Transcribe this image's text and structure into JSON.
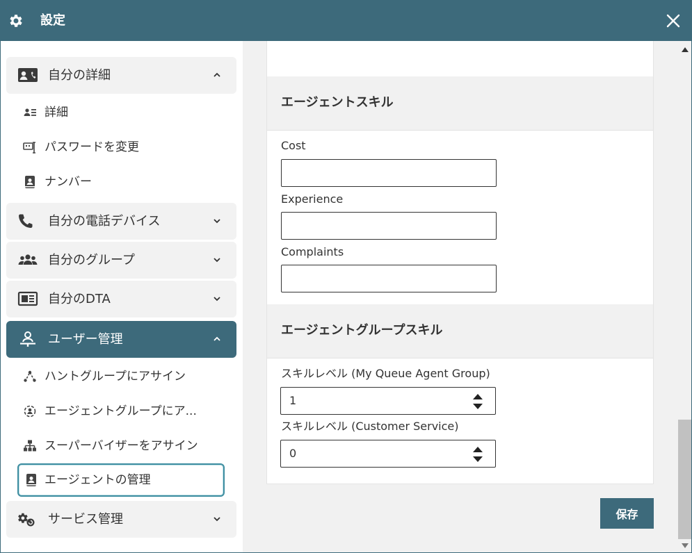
{
  "window": {
    "title": "設定",
    "accent_color": "#3d6a7b"
  },
  "sidebar": {
    "sections": [
      {
        "label": "自分の詳細",
        "icon": "contact-card-icon",
        "expanded": true,
        "items": [
          {
            "label": "詳細",
            "icon": "id-badge-icon"
          },
          {
            "label": "パスワードを変更",
            "icon": "password-icon"
          },
          {
            "label": "ナンバー",
            "icon": "phonebook-icon"
          }
        ]
      },
      {
        "label": "自分の電話デバイス",
        "icon": "phone-icon",
        "expanded": false
      },
      {
        "label": "自分のグループ",
        "icon": "group-icon",
        "expanded": false
      },
      {
        "label": "自分のDTA",
        "icon": "dta-icon",
        "expanded": false
      },
      {
        "label": "ユーザー管理",
        "icon": "user-admin-icon",
        "expanded": true,
        "active": true,
        "items": [
          {
            "label": "ハントグループにアサイン",
            "icon": "hunt-group-icon"
          },
          {
            "label": "エージェントグループにア...",
            "icon": "agent-group-icon"
          },
          {
            "label": "スーパーバイザーをアサイン",
            "icon": "hierarchy-icon"
          },
          {
            "label": "エージェントの管理",
            "icon": "agent-icon",
            "selected": true
          }
        ]
      },
      {
        "label": "サービス管理",
        "icon": "service-gear-icon",
        "expanded": false
      }
    ]
  },
  "main": {
    "agent_skills": {
      "heading": "エージェントスキル",
      "fields": [
        {
          "label": "Cost",
          "value": ""
        },
        {
          "label": "Experience",
          "value": ""
        },
        {
          "label": "Complaints",
          "value": ""
        }
      ]
    },
    "agent_group_skills": {
      "heading": "エージェントグループスキル",
      "fields": [
        {
          "label": "スキルレベル (My Queue Agent Group)",
          "value": "1"
        },
        {
          "label": "スキルレベル (Customer Service)",
          "value": "0"
        }
      ]
    },
    "save_label": "保存"
  }
}
